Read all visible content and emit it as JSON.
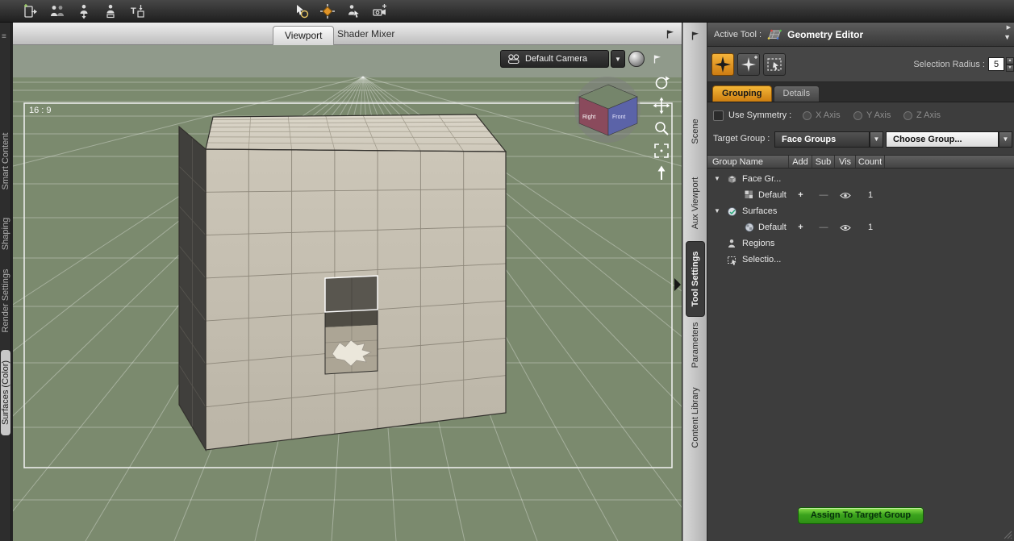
{
  "toolbar": {
    "left_icons": [
      "import-figure-icon",
      "figure-pair-icon",
      "figure-down-icon",
      "figure-floor-icon",
      "text-import-icon"
    ],
    "center_icons": [
      "node-select-icon",
      "translate-tool-icon",
      "figure-select-icon",
      "camera-add-icon"
    ]
  },
  "left_tabs": {
    "menu_icon": "≡",
    "items": [
      {
        "label": "Smart Content",
        "selected": false
      },
      {
        "label": "Shaping",
        "selected": false
      },
      {
        "label": "Render Settings",
        "selected": false
      },
      {
        "label": "Surfaces (Color)",
        "selected": true
      }
    ]
  },
  "viewport": {
    "tabs": [
      {
        "label": "Viewport",
        "active": true
      },
      {
        "label": "Shader Mixer",
        "active": false
      }
    ],
    "aspect_label": "16 : 9",
    "camera": {
      "label": "Default Camera",
      "dropdown_icon": "▼"
    },
    "view_cube": {
      "left_face_label": "Right",
      "right_face_label": "Front"
    },
    "tool_icons": [
      "orbit-icon",
      "pan-icon",
      "zoom-icon",
      "frame-icon",
      "aim-icon"
    ]
  },
  "dock_tabs": {
    "items": [
      {
        "label": "Scene",
        "active": false
      },
      {
        "label": "Aux Viewport",
        "active": false
      },
      {
        "label": "Tool Settings",
        "active": true
      },
      {
        "label": "Parameters",
        "active": false
      },
      {
        "label": "Content Library",
        "active": false
      }
    ]
  },
  "tool_panel": {
    "header": {
      "label": "Active Tool :",
      "tool_name": "Geometry Editor",
      "menu_icon": "▶",
      "dropdown_icon": "▼"
    },
    "selection_radius": {
      "label": "Selection Radius :",
      "value": "5",
      "spin_up": "▲",
      "spin_down": "▼"
    },
    "mode_icons": [
      "drag-select-icon",
      "marquee-select-icon",
      "lasso-select-icon"
    ],
    "tabs": [
      {
        "label": "Grouping",
        "active": true
      },
      {
        "label": "Details",
        "active": false
      }
    ],
    "symmetry": {
      "label": "Use Symmetry :",
      "checked": false,
      "axes": [
        "X Axis",
        "Y Axis",
        "Z Axis"
      ]
    },
    "target_group": {
      "label": "Target Group :",
      "value": "Face Groups",
      "choose_placeholder": "Choose Group...",
      "dropdown_icon": "▼"
    },
    "table": {
      "headers": [
        "Group Name",
        "Add",
        "Sub",
        "Vis",
        "Count"
      ],
      "rows": [
        {
          "label": "Face Gr...",
          "caret": "▼",
          "icon": "face-groups-icon",
          "level": 0
        },
        {
          "label": "Default",
          "icon": "checker-icon",
          "add": "+",
          "sub": "—",
          "vis": true,
          "count": "1",
          "level": 2
        },
        {
          "label": "Surfaces",
          "caret": "▼",
          "icon": "surfaces-icon",
          "level": 0
        },
        {
          "label": "Default",
          "icon": "surface-ball-icon",
          "add": "+",
          "sub": "—",
          "vis": true,
          "count": "1",
          "level": 2
        },
        {
          "label": "Regions",
          "icon": "regions-icon",
          "level": 1
        },
        {
          "label": "Selectio...",
          "icon": "selection-sets-icon",
          "level": 1
        }
      ]
    },
    "assign_button": {
      "label": "Assign To Target Group"
    }
  },
  "colors": {
    "accent_orange": "#e89c20",
    "assign_green": "#3fa31d",
    "viewport_green": "#7b8a6e",
    "cube_face_beige": "#c5bfb1",
    "cube_face_dark": "#403f3c"
  }
}
